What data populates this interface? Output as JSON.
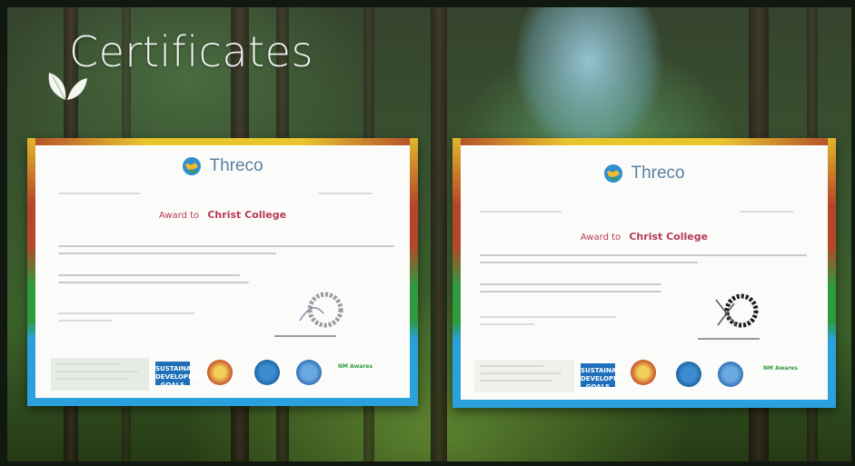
{
  "page": {
    "title": "Certificates"
  },
  "certificates": [
    {
      "brand": "Threco",
      "award_prefix": "Award to",
      "recipient": "Christ College"
    },
    {
      "brand": "Threco",
      "award_prefix": "Award to",
      "recipient": "Christ College"
    }
  ],
  "footer_logos": {
    "sdg_label": "SUSTAINABLE DEVELOPMENT GOALS",
    "mission_label": "NM Awares"
  },
  "colors": {
    "band_yellow": "#e9c52c",
    "band_red": "#b6462a",
    "band_green": "#2f9a3e",
    "band_blue": "#2aa0dc",
    "brand_blue": "#5a7fa0",
    "recipient_red": "#b73a55"
  }
}
